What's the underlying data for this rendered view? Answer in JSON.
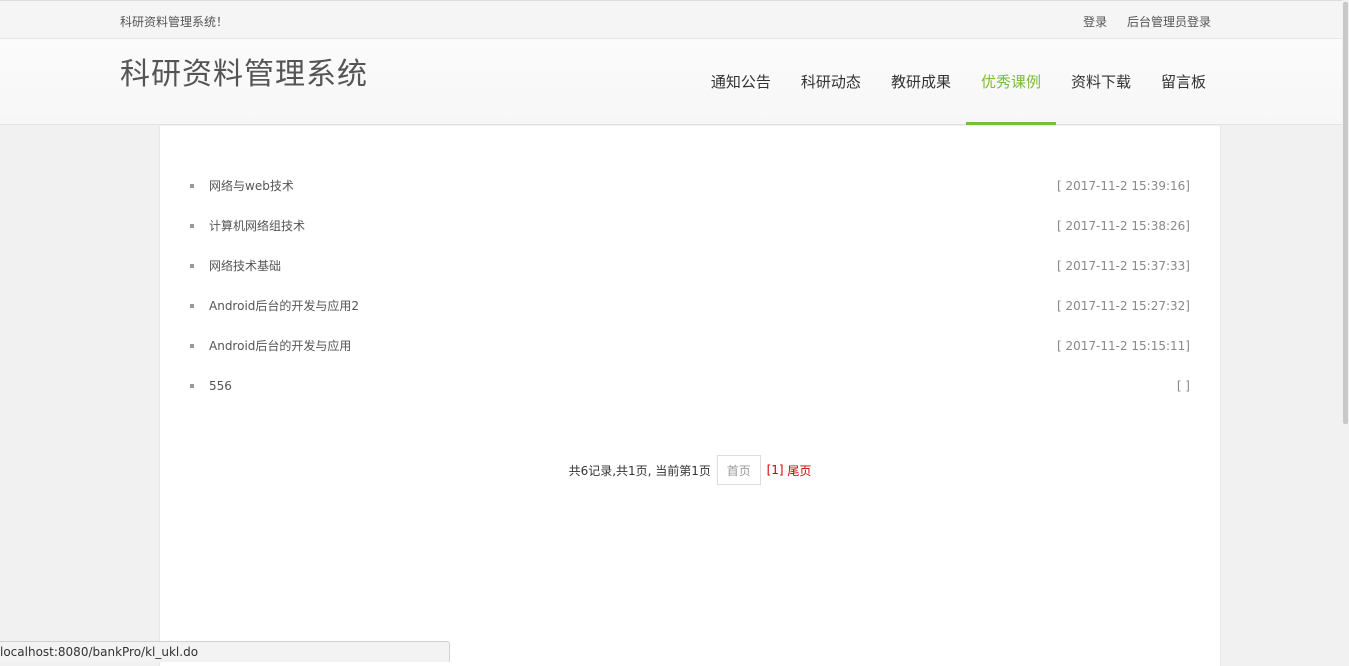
{
  "topbar": {
    "welcome": "科研资料管理系统！",
    "login": "登录",
    "admin_login": "后台管理员登录"
  },
  "header": {
    "site_title": "科研资料管理系统"
  },
  "nav": {
    "items": [
      {
        "label": "通知公告"
      },
      {
        "label": "科研动态"
      },
      {
        "label": "教研成果"
      },
      {
        "label": "优秀课例"
      },
      {
        "label": "资料下载"
      },
      {
        "label": "留言板"
      }
    ],
    "active_index": 3
  },
  "list": {
    "items": [
      {
        "title": "网络与web技术",
        "date": "[ 2017-11-2 15:39:16]"
      },
      {
        "title": "计算机网络组技术",
        "date": "[ 2017-11-2 15:38:26]"
      },
      {
        "title": "网络技术基础",
        "date": "[ 2017-11-2 15:37:33]"
      },
      {
        "title": "Android后台的开发与应用2",
        "date": "[ 2017-11-2 15:27:32]"
      },
      {
        "title": "Android后台的开发与应用",
        "date": "[ 2017-11-2 15:15:11]"
      },
      {
        "title": "556",
        "date": "[ ]"
      }
    ]
  },
  "pager": {
    "summary": "共6记录,共1页, 当前第1页",
    "first_label": "首页",
    "page_label": "[1]",
    "last_label": "尾页"
  },
  "statusbar": {
    "url": "localhost:8080/bankPro/kl_ukl.do"
  },
  "colors": {
    "accent": "#7bbd33",
    "pager_link": "#cc0000"
  }
}
